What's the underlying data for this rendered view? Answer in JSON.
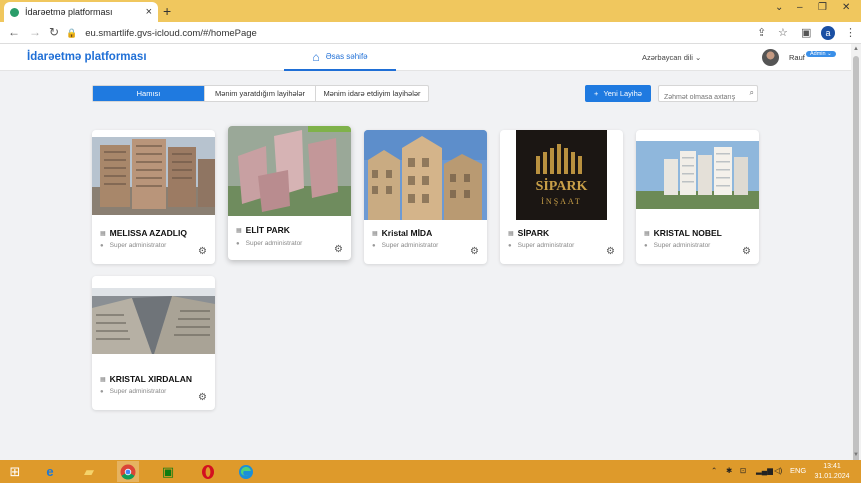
{
  "browser": {
    "tab_title": "İdarəetmə platforması",
    "tab_close": "×",
    "new_tab": "+",
    "url": "eu.smartlife.gvs-icloud.com/#/homePage",
    "profile_initial": "a",
    "win_min": "–",
    "win_max": "❐",
    "win_close": "✕",
    "back": "←",
    "forward": "→",
    "reload": "↻",
    "share": "⇪",
    "star": "☆",
    "sidepanel": "▣",
    "menu": "⋮"
  },
  "header": {
    "brand": "İdarəetmə platforması",
    "home_label": "Əsas səhifə",
    "language": "Azərbaycan dili ⌄",
    "user_name": "Rauf",
    "user_badge": "Admin ⌄"
  },
  "toolbar": {
    "filters": [
      "Hamısı",
      "Mənim yaratdığım layihələr",
      "Mənim idarə etdiyim layihələr"
    ],
    "active_filter": 0,
    "new_project_label": "Yeni Layihə",
    "search_placeholder": "Zəhmət olmasa axtarış"
  },
  "projects": [
    {
      "name": "MELISSA AZADLIQ",
      "role": "Super administrator"
    },
    {
      "name": "ELİT PARK",
      "role": "Super administrator"
    },
    {
      "name": "Kristal MİDA",
      "role": "Super administrator"
    },
    {
      "name": "SİPARK",
      "role": "Super administrator"
    },
    {
      "name": "KRISTAL NOBEL",
      "role": "Super administrator"
    },
    {
      "name": "KRISTAL XIRDALAN",
      "role": "Super administrator"
    }
  ],
  "sipark_logo": {
    "line1": "SİPARK",
    "line2": "İNŞAAT"
  },
  "taskbar": {
    "lang": "ENG",
    "time": "13:41",
    "date": "31.01.2024"
  },
  "colors": {
    "accent": "#1f7ae0",
    "taskbar": "#de9a2b",
    "tabstrip": "#f0c75e"
  }
}
